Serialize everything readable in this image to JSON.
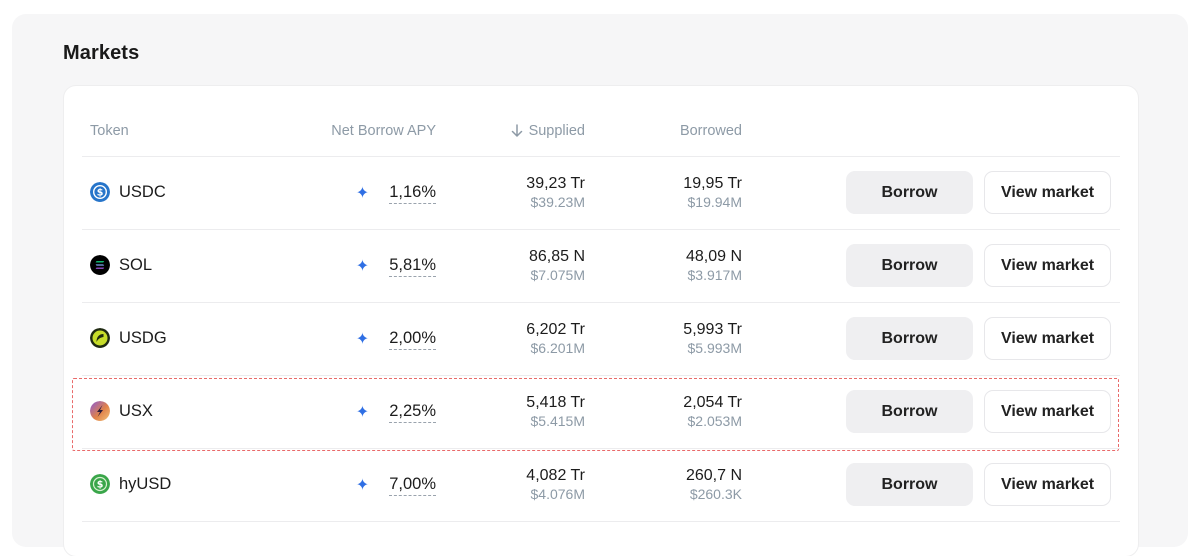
{
  "section": {
    "title": "Markets"
  },
  "table": {
    "headers": {
      "token": "Token",
      "net_borrow_apy": "Net Borrow APY",
      "supplied": "Supplied",
      "borrowed": "Borrowed"
    },
    "sort_icon": "arrow-down-icon",
    "rows": [
      {
        "token": "USDC",
        "icon": "usdc-icon",
        "apy": "1,16%",
        "supplied": "39,23 Tr",
        "supplied_usd": "$39.23M",
        "borrowed": "19,95 Tr",
        "borrowed_usd": "$19.94M",
        "borrow_label": "Borrow",
        "view_label": "View market"
      },
      {
        "token": "SOL",
        "icon": "sol-icon",
        "apy": "5,81%",
        "supplied": "86,85 N",
        "supplied_usd": "$7.075M",
        "borrowed": "48,09 N",
        "borrowed_usd": "$3.917M",
        "borrow_label": "Borrow",
        "view_label": "View market"
      },
      {
        "token": "USDG",
        "icon": "usdg-icon",
        "apy": "2,00%",
        "supplied": "6,202 Tr",
        "supplied_usd": "$6.201M",
        "borrowed": "5,993 Tr",
        "borrowed_usd": "$5.993M",
        "borrow_label": "Borrow",
        "view_label": "View market"
      },
      {
        "token": "USX",
        "icon": "usx-icon",
        "apy": "2,25%",
        "supplied": "5,418 Tr",
        "supplied_usd": "$5.415M",
        "borrowed": "2,054 Tr",
        "borrowed_usd": "$2.053M",
        "borrow_label": "Borrow",
        "view_label": "View market",
        "highlighted": true
      },
      {
        "token": "hyUSD",
        "icon": "hyusd-icon",
        "apy": "7,00%",
        "supplied": "4,082 Tr",
        "supplied_usd": "$4.076M",
        "borrowed": "260,7 N",
        "borrowed_usd": "$260.3K",
        "borrow_label": "Borrow",
        "view_label": "View market"
      }
    ]
  },
  "colors": {
    "accent_sparkle": "#2f6fe4",
    "highlight_border": "#e96a6a",
    "usdc": "#2775ca",
    "sol": "#000000",
    "usdg": "#c7dd2a",
    "usx": "#e0824a",
    "hyusd": "#3aa64a"
  }
}
